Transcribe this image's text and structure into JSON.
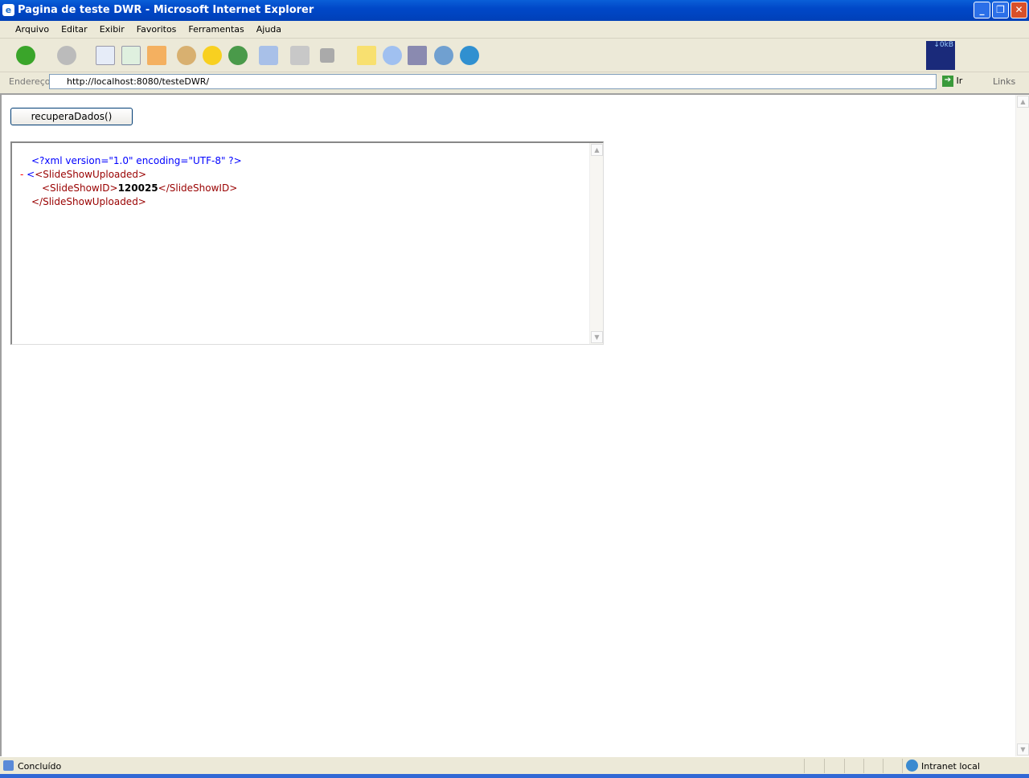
{
  "window": {
    "title": "Pagina de teste DWR - Microsoft Internet Explorer"
  },
  "menu": [
    "Arquivo",
    "Editar",
    "Exibir",
    "Favoritos",
    "Ferramentas",
    "Ajuda"
  ],
  "address": {
    "label": "Endereço",
    "url": "http://localhost:8080/testeDWR/",
    "go": "Ir",
    "links": "Links"
  },
  "net_meter": "↓0kB",
  "page": {
    "button": "recuperaDados()",
    "xml": {
      "decl": "<?xml version=\"1.0\" encoding=\"UTF-8\" ?>",
      "collapse": "-",
      "root_open": "<SlideShowUploaded>",
      "child_open": "<SlideShowID>",
      "child_value": "120025",
      "child_close": "</SlideShowID>",
      "root_close": "</SlideShowUploaded>"
    }
  },
  "status": {
    "text": "Concluído",
    "zone": "Intranet local"
  }
}
